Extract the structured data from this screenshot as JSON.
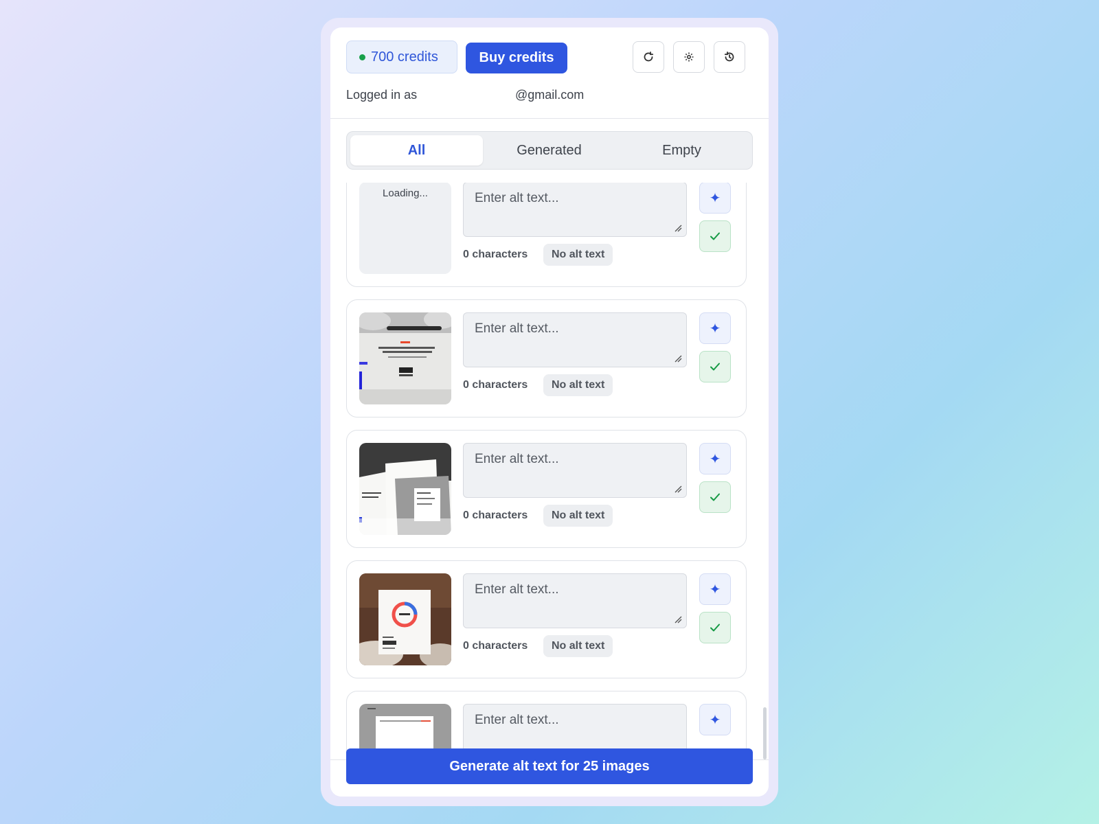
{
  "header": {
    "credits_label": "700 credits",
    "buy_label": "Buy credits",
    "logged_in_prefix": "Logged in as",
    "email": "@gmail.com",
    "icons": [
      "refresh-icon",
      "gear-icon",
      "history-icon"
    ]
  },
  "tabs": [
    {
      "label": "All",
      "active": true
    },
    {
      "label": "Generated",
      "active": false
    },
    {
      "label": "Empty",
      "active": false
    }
  ],
  "items": [
    {
      "thumb": "loading",
      "thumb_text": "Loading...",
      "placeholder": "Enter alt text...",
      "count": "0 characters",
      "status": "No alt text"
    },
    {
      "thumb": "website-screenshot",
      "placeholder": "Enter alt text...",
      "count": "0 characters",
      "status": "No alt text"
    },
    {
      "thumb": "stacked-pages",
      "placeholder": "Enter alt text...",
      "count": "0 characters",
      "status": "No alt text"
    },
    {
      "thumb": "donut-chart-photo",
      "placeholder": "Enter alt text...",
      "count": "0 characters",
      "status": "No alt text"
    },
    {
      "thumb": "document-page",
      "placeholder": "Enter alt text...",
      "count": "",
      "status": ""
    }
  ],
  "footer": {
    "cta_label": "Generate alt text for 25 images"
  },
  "colors": {
    "accent": "#2f56e0",
    "success": "#159a44"
  }
}
